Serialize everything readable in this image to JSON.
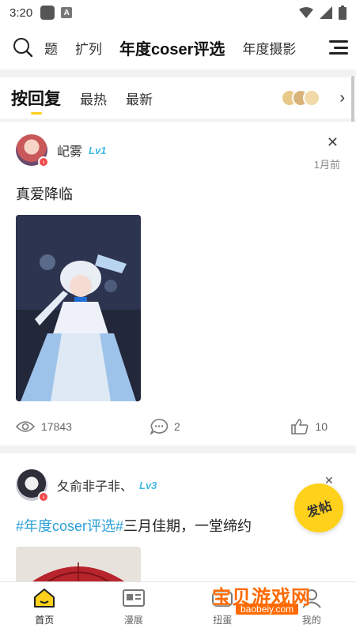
{
  "status": {
    "time": "3:20",
    "app_badge": "A"
  },
  "topnav": {
    "tabs": [
      {
        "label": "题"
      },
      {
        "label": "扩列"
      },
      {
        "label": "年度coser评选"
      },
      {
        "label": "年度摄影"
      }
    ]
  },
  "sortbar": {
    "items": [
      {
        "label": "按回复"
      },
      {
        "label": "最热"
      },
      {
        "label": "最新"
      }
    ]
  },
  "posts": [
    {
      "username": "屺雾",
      "level": "Lv1",
      "time": "1月前",
      "title": "真爱降临",
      "views": "17843",
      "comments": "2",
      "likes": "10"
    },
    {
      "username": "夂俞非子非、",
      "level": "Lv3",
      "title_tag": "#年度coser评选#",
      "title_text": "三月佳期，一堂缔约"
    }
  ],
  "fab": {
    "label": "发帖"
  },
  "bottomnav": {
    "items": [
      {
        "label": "首页"
      },
      {
        "label": "漫展"
      },
      {
        "label": "扭蛋"
      },
      {
        "label": "我的"
      }
    ]
  },
  "watermark": {
    "text": "宝贝游戏网",
    "sub": "baobeiy.com"
  },
  "colors": {
    "accent": "#ffd11a",
    "tag": "#2b9fd8",
    "level": "#3fb9e6"
  }
}
